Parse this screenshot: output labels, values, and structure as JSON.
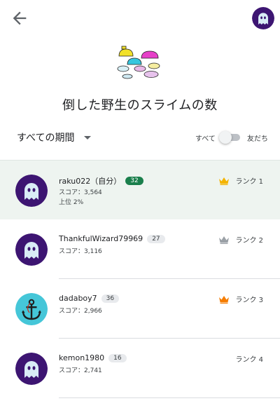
{
  "page": {
    "title": "倒した野生のスライムの数"
  },
  "filters": {
    "period_label": "すべての期間",
    "toggle_all_label": "すべて",
    "toggle_friends_label": "友だち"
  },
  "colors": {
    "self_row_bg": "#eef4f0",
    "self_level_badge": "#1a7f4c",
    "gold_crown": "#f4b400",
    "silver_crown": "#9aa0a6",
    "bronze_crown": "#f57c00",
    "ghost_avatar_bg": "#3d1572",
    "anchor_avatar_bg": "#45c6d8"
  },
  "leaderboard": {
    "rows": [
      {
        "name": "raku022（自分）",
        "level": "32",
        "score": "スコア：3,564",
        "percentile": "上位 2%",
        "rank": "ランク 1",
        "crown": "gold",
        "avatar": "ghost"
      },
      {
        "name": "ThankfulWizard79969",
        "level": "27",
        "score": "スコア：3,116",
        "rank": "ランク 2",
        "crown": "silver",
        "avatar": "ghost"
      },
      {
        "name": "dadaboy7",
        "level": "36",
        "score": "スコア：2,966",
        "rank": "ランク 3",
        "crown": "bronze",
        "avatar": "anchor"
      },
      {
        "name": "kemon1980",
        "level": "16",
        "score": "スコア：2,741",
        "rank": "ランク 4",
        "crown": "none",
        "avatar": "ghost"
      }
    ]
  }
}
